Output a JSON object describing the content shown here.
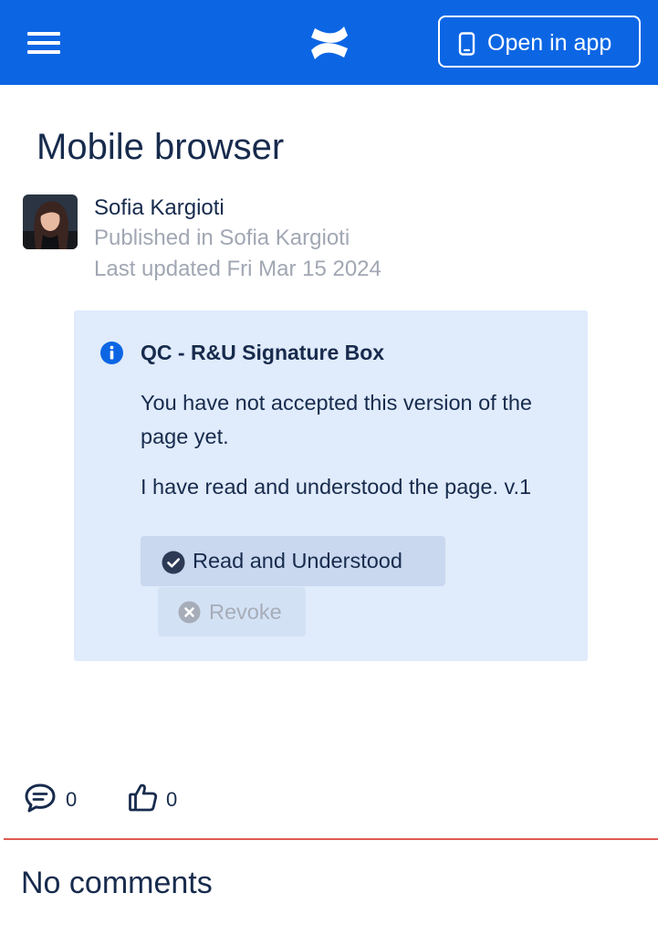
{
  "header": {
    "menu_icon": "hamburger-menu-icon",
    "logo_icon": "confluence-logo-icon",
    "open_in_app_label": "Open in app",
    "open_in_app_icon": "mobile-phone-icon",
    "background_color": "#0c66e4"
  },
  "page": {
    "title": "Mobile browser",
    "author": "Sofia Kargioti",
    "published": "Published in Sofia Kargioti",
    "last_updated": "Last updated Fri Mar 15 2024"
  },
  "signature_box": {
    "icon": "info-icon",
    "title": "QC - R&U Signature Box",
    "status_message": "You have not accepted this version of the page yet.",
    "statement": "I have read and understood the page. v.1",
    "read_button_label": "Read and Understood",
    "read_button_icon": "check-circle-icon",
    "revoke_button_label": "Revoke",
    "revoke_button_icon": "x-circle-icon",
    "background_color": "#e0ebfb"
  },
  "stats": {
    "comments_icon": "comment-icon",
    "comments_count": "0",
    "likes_icon": "thumbs-up-icon",
    "likes_count": "0"
  },
  "comments": {
    "empty_label": "No comments",
    "divider_color": "#e05a50"
  }
}
